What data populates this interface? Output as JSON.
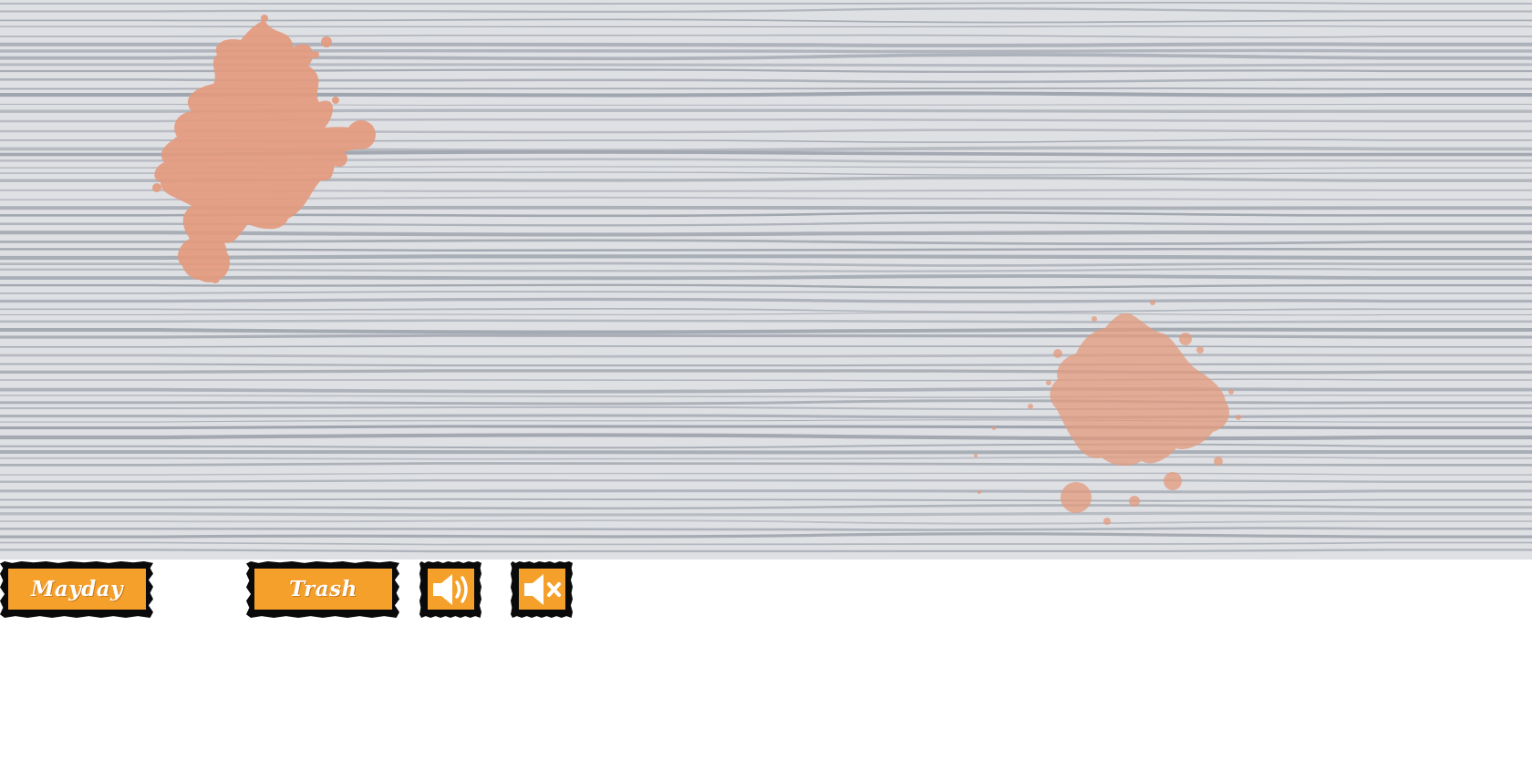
{
  "board": {
    "background_color": "#dfe0e4",
    "line_color": "#9ea4ad",
    "splat_color": "#e49a7c"
  },
  "toolbar": {
    "mayday_label": "Mayday",
    "trash_label": "Trash",
    "sound_on_icon": "speaker-on-icon",
    "sound_off_icon": "speaker-muted-icon",
    "button_color": "#f5a02a"
  }
}
